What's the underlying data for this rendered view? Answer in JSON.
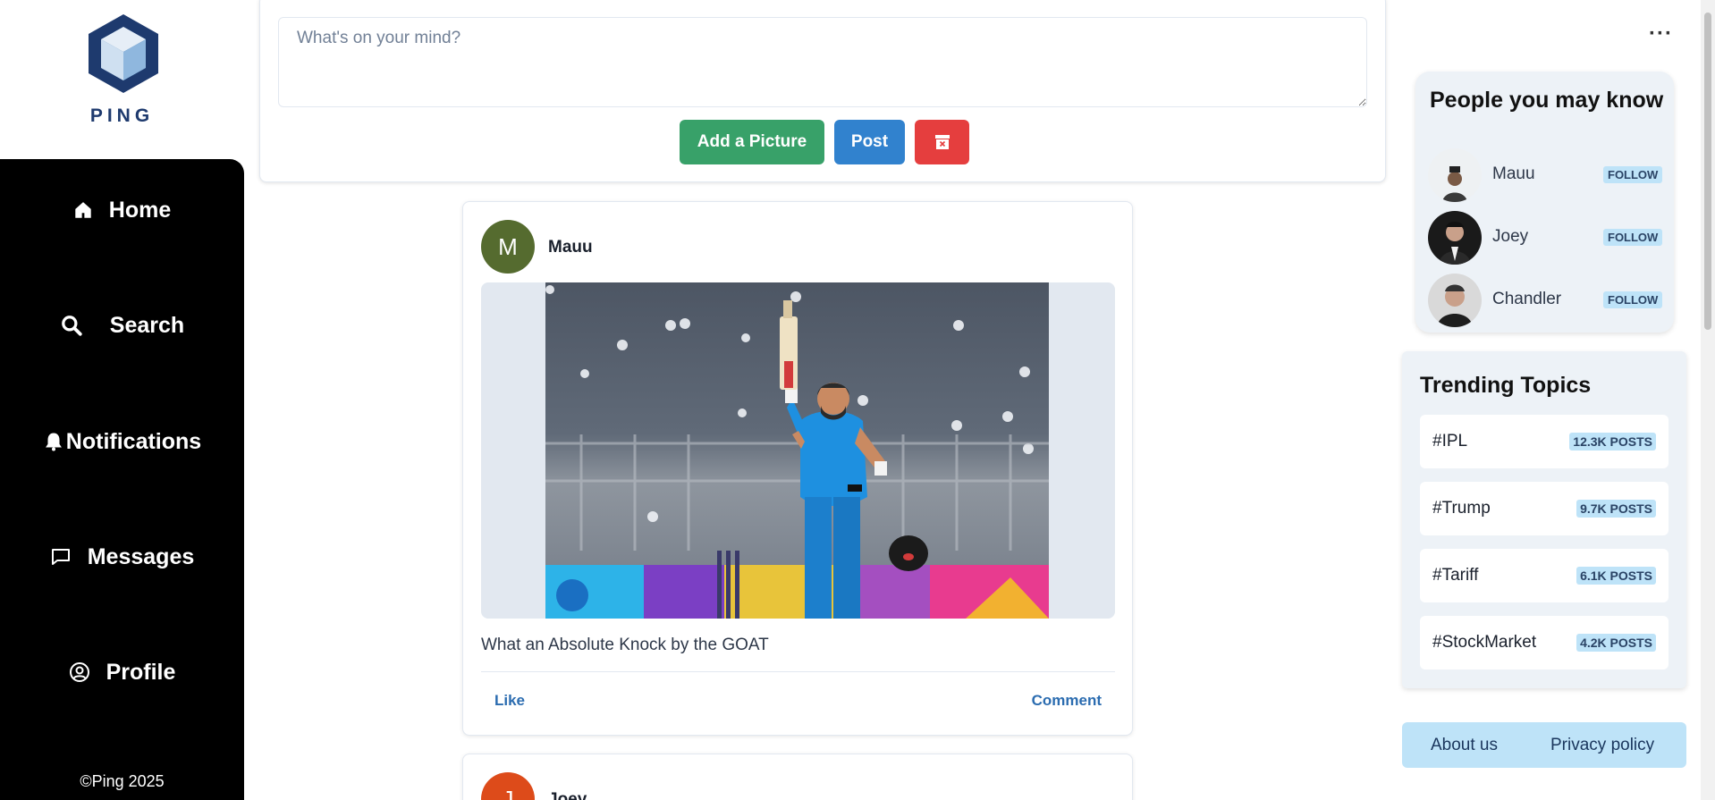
{
  "brand": {
    "name": "PING"
  },
  "nav": {
    "items": [
      {
        "label": "Home",
        "icon": "home-icon"
      },
      {
        "label": "Search",
        "icon": "search-icon"
      },
      {
        "label": "Notifications",
        "icon": "bell-icon"
      },
      {
        "label": "Messages",
        "icon": "message-icon"
      },
      {
        "label": "Profile",
        "icon": "user-circle-icon"
      }
    ],
    "copyright": "©Ping 2025"
  },
  "composer": {
    "placeholder": "What's on your mind?",
    "add_picture_label": "Add a Picture",
    "post_label": "Post",
    "clear_icon": "archive-x-icon"
  },
  "posts": [
    {
      "avatar_letter": "M",
      "avatar_color": "#556b2f",
      "author": "Mauu",
      "text": "What an Absolute Knock by the GOAT",
      "like_label": "Like",
      "comment_label": "Comment"
    },
    {
      "avatar_letter": "J",
      "avatar_color": "#dd4b1a",
      "author": "Joey"
    }
  ],
  "people_you_may_know": {
    "title": "People you may know",
    "people": [
      {
        "name": "Mauu",
        "follow_label": "FOLLOW"
      },
      {
        "name": "Joey",
        "follow_label": "FOLLOW"
      },
      {
        "name": "Chandler",
        "follow_label": "FOLLOW"
      }
    ]
  },
  "trending": {
    "title": "Trending Topics",
    "topics": [
      {
        "tag": "#IPL",
        "count": "12.3K POSTS"
      },
      {
        "tag": "#Trump",
        "count": "9.7K POSTS"
      },
      {
        "tag": "#Tariff",
        "count": "6.1K POSTS"
      },
      {
        "tag": "#StockMarket",
        "count": "4.2K POSTS"
      }
    ]
  },
  "footer": {
    "about_label": "About us",
    "privacy_label": "Privacy policy"
  },
  "colors": {
    "sidebar": "#000000",
    "green": "#38a169",
    "blue": "#3182ce",
    "red": "#e53e3e",
    "badge": "#bee3f8"
  }
}
